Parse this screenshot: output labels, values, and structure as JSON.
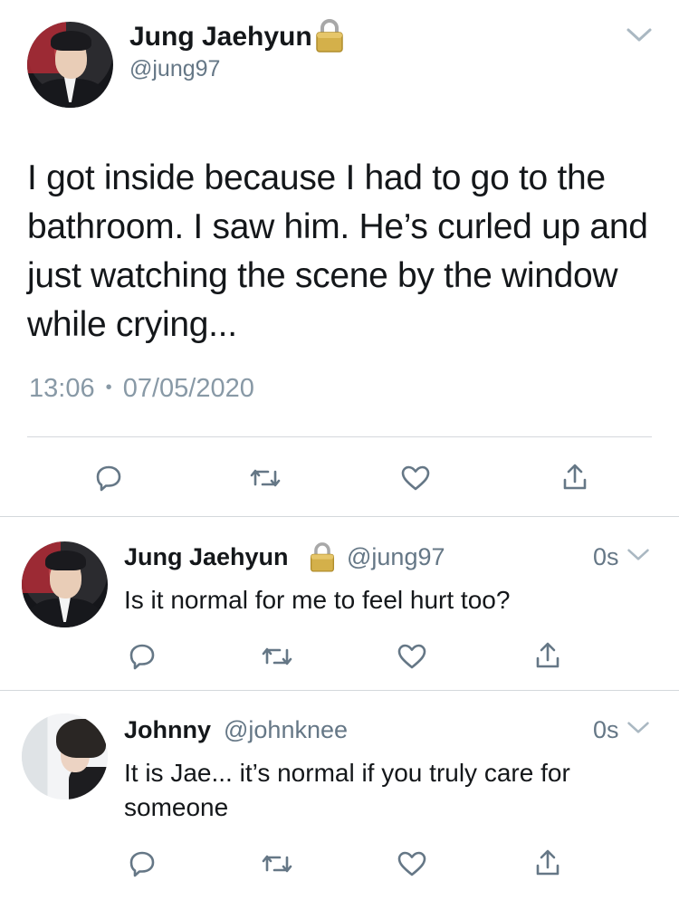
{
  "main_tweet": {
    "author_name": "Jung Jaehyun",
    "author_handle": "@jung97",
    "text": "I got inside because I had to go to the bathroom. I saw him. He’s curled up and just watching the scene by the window while crying...",
    "time": "13:06",
    "separator": "•",
    "date": "07/05/2020"
  },
  "replies": [
    {
      "author_name": "Jung Jaehyun",
      "author_handle": "@jung97",
      "time": "0s",
      "text": "Is it normal for me to feel hurt too?"
    },
    {
      "author_name": "Johnny",
      "author_handle": "@johnknee",
      "time": "0s",
      "text": "It is Jae... it’s normal if you truly care for someone"
    }
  ],
  "icons": {
    "reply": "reply-icon",
    "retweet": "retweet-icon",
    "like": "heart-icon",
    "share": "share-icon",
    "lock": "lock-icon",
    "more": "chevron-down-icon"
  },
  "colors": {
    "text": "#14171a",
    "secondary": "#657786",
    "icon": "#657786",
    "lock_gold": "#c9a238",
    "divider": "#d4d8dc"
  }
}
